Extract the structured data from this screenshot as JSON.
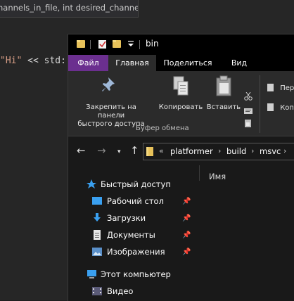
{
  "editor": {
    "tooltip_text": "hannels_in_file, int desired_channels",
    "code_string": "\"Hi\"",
    "code_op": " << std:"
  },
  "explorer": {
    "window_title": "bin",
    "tabs": [
      {
        "label": "Файл"
      },
      {
        "label": "Главная"
      },
      {
        "label": "Поделиться"
      },
      {
        "label": "Вид"
      }
    ],
    "ribbon": {
      "pin_label": "Закрепить на панели быстрого доступа",
      "pin_label_line1": "Закрепить на панели",
      "pin_label_line2": "быстрого доступа",
      "copy_label": "Копировать",
      "paste_label": "Вставить",
      "group_label": "Буфер обмена",
      "move_label": "Пер",
      "copyto_label": "Коп"
    },
    "breadcrumb": [
      "platformer",
      "build",
      "msvc"
    ],
    "breadcrumb_prefix": "«",
    "column_header": "Имя",
    "sidebar": {
      "quick_access": "Быстрый доступ",
      "items": [
        {
          "label": "Рабочий стол",
          "icon": "desktop-icon",
          "pinned": true
        },
        {
          "label": "Загрузки",
          "icon": "downloads-icon",
          "pinned": true
        },
        {
          "label": "Документы",
          "icon": "documents-icon",
          "pinned": true
        },
        {
          "label": "Изображения",
          "icon": "pictures-icon",
          "pinned": true
        }
      ],
      "this_pc": "Этот компьютер",
      "video": "Видео"
    }
  },
  "colors": {
    "file_tab": "#6b2f8f",
    "folder": "#e8c25a",
    "accent_blue": "#3aa0f0"
  }
}
